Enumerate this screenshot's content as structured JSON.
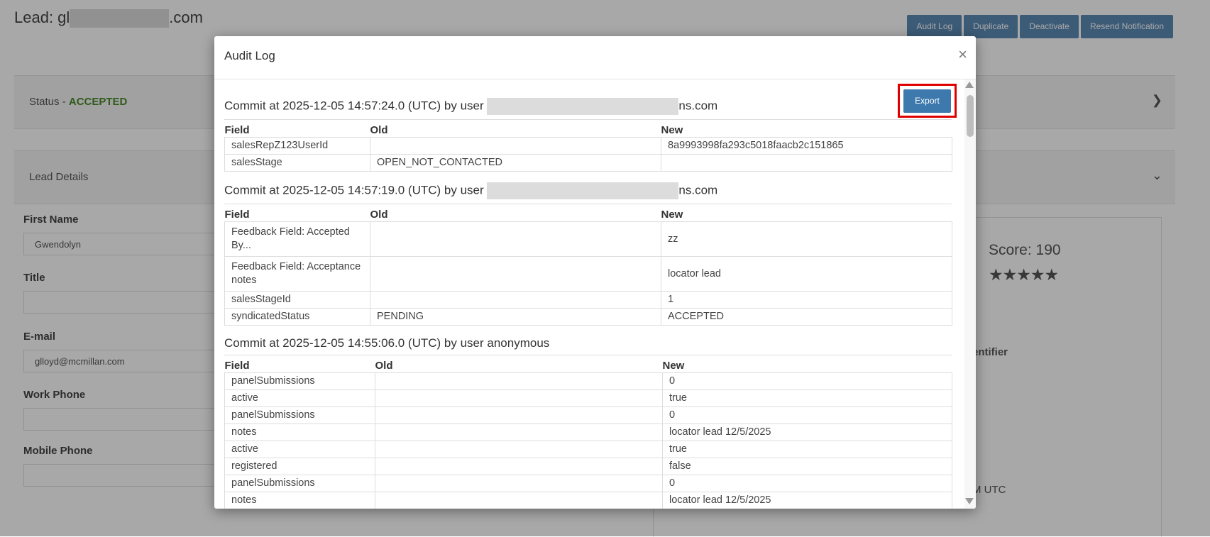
{
  "page": {
    "title_prefix": "Lead: gl",
    "title_suffix": ".com",
    "actions": [
      "Audit Log",
      "Duplicate",
      "Deactivate",
      "Resend Notification"
    ],
    "status_label": "Status - ",
    "status_value": "ACCEPTED",
    "details_label": "Lead Details",
    "fields": [
      {
        "label": "First Name",
        "value": "Gwendolyn"
      },
      {
        "label": "Title",
        "value": ""
      },
      {
        "label": "E-mail",
        "value": "glloyd@mcmillan.com"
      },
      {
        "label": "Work Phone",
        "value": ""
      },
      {
        "label": "Mobile Phone",
        "value": ""
      }
    ],
    "score": "Score: 190",
    "stars": "★★★★★",
    "identifier_fragment": "entifier",
    "utc_fragment": "M UTC"
  },
  "modal": {
    "title": "Audit Log",
    "close": "×",
    "export_label": "Export",
    "columns": {
      "field": "Field",
      "old": "Old",
      "new": "New"
    },
    "commits": [
      {
        "heading_prefix": "Commit at 2025-12-05 14:57:24.0 (UTC) by user ",
        "heading_suffix": "ns.com",
        "rows": [
          {
            "field": "salesRepZ123UserId",
            "old": "",
            "new": "8a9993998fa293c5018faacb2c151865"
          },
          {
            "field": "salesStage",
            "old": "OPEN_NOT_CONTACTED",
            "new": ""
          }
        ]
      },
      {
        "heading_prefix": "Commit at 2025-12-05 14:57:19.0 (UTC) by user ",
        "heading_suffix": "ns.com",
        "rows": [
          {
            "field": "Feedback Field: Accepted By...",
            "old": "",
            "new": "zz"
          },
          {
            "field": "Feedback Field: Acceptance notes",
            "old": "",
            "new": "locator lead"
          },
          {
            "field": "salesStageId",
            "old": "",
            "new": "1"
          },
          {
            "field": "syndicatedStatus",
            "old": "PENDING",
            "new": "ACCEPTED"
          }
        ]
      },
      {
        "heading_prefix": "Commit at 2025-12-05 14:55:06.0 (UTC) by user anonymous",
        "heading_suffix": "",
        "rows": [
          {
            "field": "panelSubmissions",
            "old": "",
            "new": "0"
          },
          {
            "field": "active",
            "old": "",
            "new": "true"
          },
          {
            "field": "panelSubmissions",
            "old": "",
            "new": "0"
          },
          {
            "field": "notes",
            "old": "",
            "new": "locator lead 12/5/2025"
          },
          {
            "field": "active",
            "old": "",
            "new": "true"
          },
          {
            "field": "registered",
            "old": "",
            "new": "false"
          },
          {
            "field": "panelSubmissions",
            "old": "",
            "new": "0"
          },
          {
            "field": "notes",
            "old": "",
            "new": "locator lead 12/5/2025"
          }
        ]
      }
    ]
  }
}
